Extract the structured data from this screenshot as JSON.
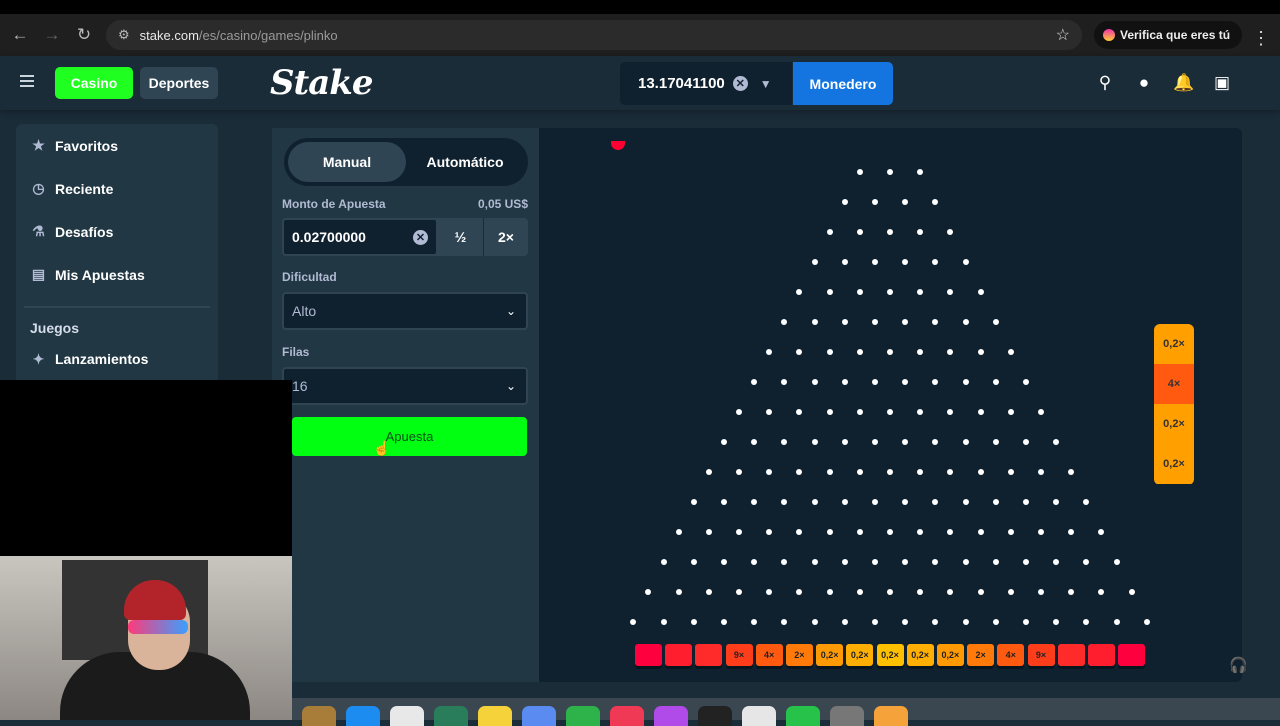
{
  "browser": {
    "url_host": "stake.com",
    "url_path": "/es/casino/games/plinko",
    "verify_label": "Verifica que eres tú"
  },
  "header": {
    "casino_label": "Casino",
    "sports_label": "Deportes",
    "logo_text": "Stake",
    "balance": "13.17041100",
    "wallet_label": "Monedero"
  },
  "sidebar": {
    "items": [
      {
        "label": "Favoritos",
        "icon": "star-icon"
      },
      {
        "label": "Reciente",
        "icon": "clock-icon"
      },
      {
        "label": "Desafíos",
        "icon": "flask-icon"
      },
      {
        "label": "Mis Apuestas",
        "icon": "bets-icon"
      }
    ],
    "section_title": "Juegos",
    "launches_label": "Lanzamientos"
  },
  "panel": {
    "tab_manual": "Manual",
    "tab_auto": "Automático",
    "bet_amount_label": "Monto de Apuesta",
    "bet_amount_usd": "0,05 US$",
    "bet_value": "0.02700000",
    "half_label": "½",
    "double_label": "2×",
    "difficulty_label": "Dificultad",
    "difficulty_value": "Alto",
    "rows_label": "Filas",
    "rows_value": "16",
    "bet_button": "Apuesta"
  },
  "board": {
    "rows": 16,
    "slots": [
      {
        "label": "",
        "color": "#ff003f"
      },
      {
        "label": "",
        "color": "#ff1e2e"
      },
      {
        "label": "",
        "color": "#ff2a2a"
      },
      {
        "label": "9×",
        "color": "#ff3d1a"
      },
      {
        "label": "4×",
        "color": "#ff5a10"
      },
      {
        "label": "2×",
        "color": "#ff7a08"
      },
      {
        "label": "0,2×",
        "color": "#ff9a05"
      },
      {
        "label": "0,2×",
        "color": "#ffae03"
      },
      {
        "label": "0,2×",
        "color": "#ffc000"
      },
      {
        "label": "0,2×",
        "color": "#ffae03"
      },
      {
        "label": "0,2×",
        "color": "#ff9a05"
      },
      {
        "label": "2×",
        "color": "#ff7a08"
      },
      {
        "label": "4×",
        "color": "#ff5a10"
      },
      {
        "label": "9×",
        "color": "#ff3d1a"
      },
      {
        "label": "",
        "color": "#ff2a2a"
      },
      {
        "label": "",
        "color": "#ff1e2e"
      },
      {
        "label": "",
        "color": "#ff003f"
      }
    ],
    "history": [
      {
        "label": "0,2×",
        "color": "#ffa000"
      },
      {
        "label": "4×",
        "color": "#ff5a10"
      },
      {
        "label": "0,2×",
        "color": "#ffa000"
      },
      {
        "label": "0,2×",
        "color": "#ffa000"
      }
    ]
  },
  "colors": {
    "accent_green": "#1fff20",
    "bet_green": "#00ff10",
    "wallet_blue": "#1475e1",
    "bg": "#1a2c38"
  }
}
